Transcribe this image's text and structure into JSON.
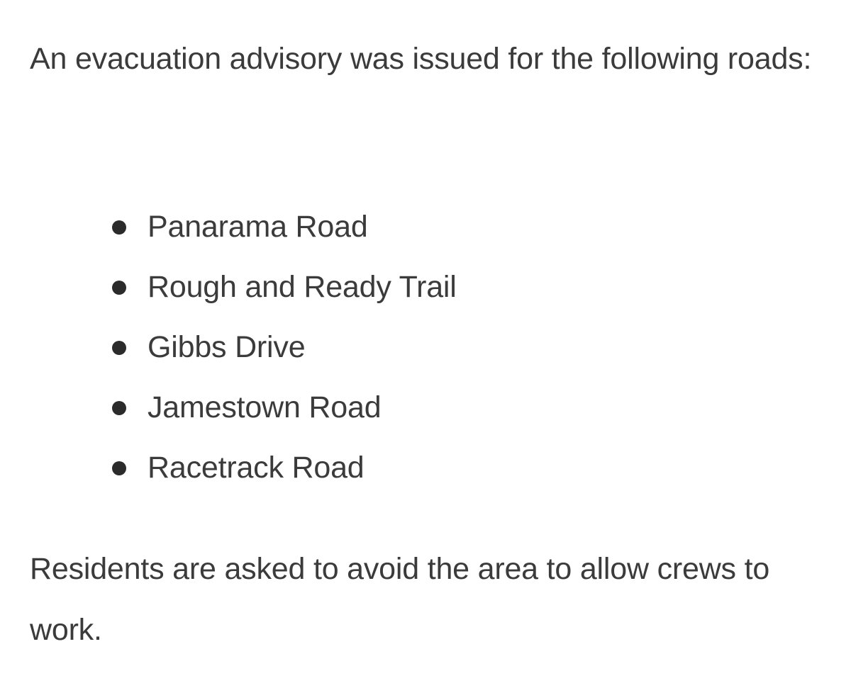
{
  "intro": {
    "text": "An evacuation advisory was issued for the following roads:"
  },
  "roads": [
    {
      "label": "Panarama Road"
    },
    {
      "label": "Rough and Ready Trail"
    },
    {
      "label": "Gibbs Drive"
    },
    {
      "label": "Jamestown Road"
    },
    {
      "label": "Racetrack Road"
    }
  ],
  "closing": {
    "text": "Residents are asked to avoid the area to allow crews to work."
  },
  "colors": {
    "text": "#3b3b3b",
    "bullet": "#2b2b2b",
    "background": "#ffffff"
  }
}
